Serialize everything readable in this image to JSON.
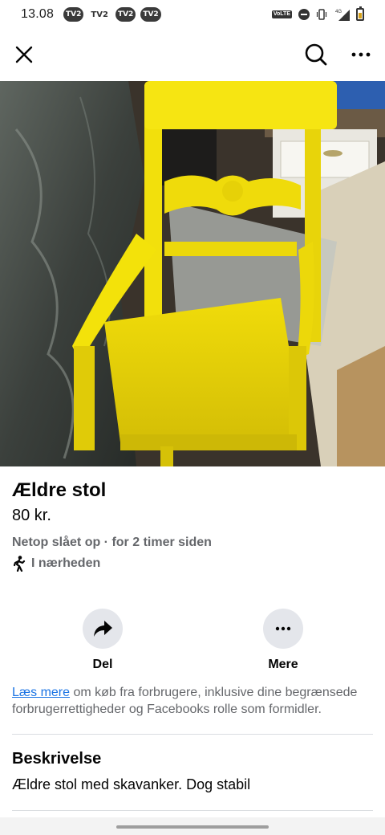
{
  "status_bar": {
    "time": "13.08",
    "notifications": [
      "TV2",
      "TV2",
      "TV2",
      "TV2"
    ],
    "volte_label": "VoLTE",
    "network_label": "4G",
    "icons": [
      "do-not-disturb-icon",
      "vibrate-icon",
      "signal-icon",
      "battery-icon"
    ]
  },
  "top_bar": {
    "icons": [
      "close-icon",
      "search-icon",
      "more-icon"
    ]
  },
  "listing": {
    "title": "Ældre stol",
    "price": "80 kr.",
    "meta": "Netop slået op · for 2 timer siden",
    "location": "I nærheden",
    "photo_subject": "yellow wooden armchair"
  },
  "actions": {
    "share_label": "Del",
    "more_label": "Mere"
  },
  "notice": {
    "link_text": "Læs mere",
    "text": " om køb fra forbrugere, inklusive dine begrænsede forbrugerrettigheder og Facebooks rolle som formidler."
  },
  "description": {
    "heading": "Beskrivelse",
    "text": "Ældre stol med skavanker. Dog stabil"
  },
  "colors": {
    "link": "#1b74e4",
    "secondary_text": "#65676b",
    "button_bg": "#e4e6eb",
    "chair_yellow": "#f3e20a"
  }
}
